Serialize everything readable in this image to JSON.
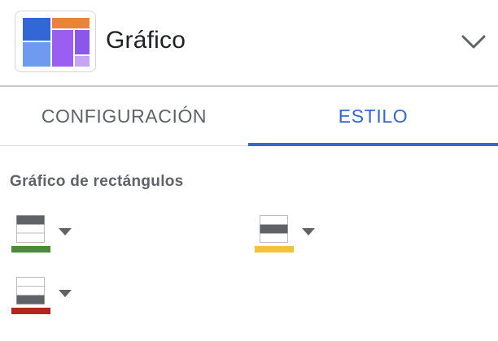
{
  "header": {
    "title": "Gráfico",
    "chart_icon": "treemap-chart-icon",
    "collapse_icon": "chevron-down-icon"
  },
  "tabs": [
    {
      "label": "CONFIGURACIÓN",
      "active": false
    },
    {
      "label": "ESTILO",
      "active": true
    }
  ],
  "section": {
    "title": "Gráfico de rectángulos"
  },
  "color_pickers": [
    {
      "name": "header-color-picker",
      "color": "#4a8a3a",
      "highlight": "top"
    },
    {
      "name": "middle-color-picker",
      "color": "#f4c13c",
      "highlight": "middle"
    },
    {
      "name": "footer-color-picker",
      "color": "#b3261e",
      "highlight": "bottom"
    }
  ],
  "colors": {
    "accent": "#3367d6",
    "treemap": [
      "#3367d6",
      "#e8843a",
      "#8a57e8",
      "#9a5ef0",
      "#6f9bef",
      "#c6a4f5"
    ]
  }
}
